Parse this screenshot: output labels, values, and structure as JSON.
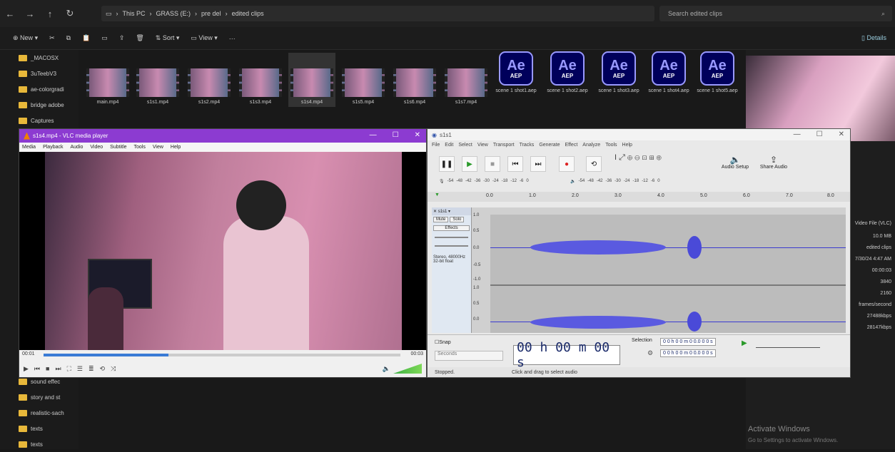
{
  "explorer": {
    "breadcrumbs": [
      "This PC",
      "GRASS (E:)",
      "pre del",
      "edited clips"
    ],
    "search_placeholder": "Search edited clips",
    "toolbar": {
      "new": "New",
      "sort": "Sort",
      "view": "View",
      "more": "···",
      "details": "Details"
    },
    "nav_items": [
      "_MACOSX",
      "3uTeebV3",
      "ae-colorgradi",
      "bridge adobe",
      "Captures",
      "sound effec",
      "story and st",
      "realistic-sach",
      "texts",
      "texts"
    ],
    "files": [
      {
        "name": "main.mp4",
        "kind": "video"
      },
      {
        "name": "s1s1.mp4",
        "kind": "video"
      },
      {
        "name": "s1s2.mp4",
        "kind": "video"
      },
      {
        "name": "s1s3.mp4",
        "kind": "video"
      },
      {
        "name": "s1s4.mp4",
        "kind": "video",
        "selected": true
      },
      {
        "name": "s1s5.mp4",
        "kind": "video"
      },
      {
        "name": "s1s6.mp4",
        "kind": "video"
      },
      {
        "name": "s1s7.mp4",
        "kind": "video"
      },
      {
        "name": "scene 1 shot1.aep",
        "kind": "aep"
      },
      {
        "name": "scene 1 shot2.aep",
        "kind": "aep"
      },
      {
        "name": "scene 1 shot3.aep",
        "kind": "aep"
      },
      {
        "name": "scene 1 shot4.aep",
        "kind": "aep"
      },
      {
        "name": "scene 1 shot5.aep",
        "kind": "aep"
      }
    ],
    "ae_logo": "Ae",
    "aep_badge": "AEP",
    "details_props": [
      "Video File (VLC)",
      "10.0 MB",
      "edited clips",
      "7/30/24 4:47 AM",
      "00:00:03",
      "3840",
      "2160",
      "frames/second",
      "27488kbps",
      "28147kbps"
    ],
    "activate_title": "Activate Windows",
    "activate_sub": "Go to Settings to activate Windows."
  },
  "vlc": {
    "title": "s1s4.mp4 - VLC media player",
    "menu": [
      "Media",
      "Playback",
      "Audio",
      "Video",
      "Subtitle",
      "Tools",
      "View",
      "Help"
    ],
    "time_elapsed": "00:01",
    "time_total": "00:03",
    "progress": 0.35,
    "volume_label": "80%"
  },
  "audacity": {
    "title": "s1s1",
    "menu": [
      "File",
      "Edit",
      "Select",
      "View",
      "Transport",
      "Tracks",
      "Generate",
      "Effect",
      "Analyze",
      "Tools",
      "Help"
    ],
    "audio_setup": "Audio Setup",
    "share_audio": "Share Audio",
    "meter_ticks": [
      "-54",
      "-48",
      "-42",
      "-36",
      "-30",
      "-24",
      "-18",
      "-12",
      "-6",
      "0"
    ],
    "timeline_ticks": [
      "0.0",
      "1.0",
      "2.0",
      "3.0",
      "4.0",
      "5.0",
      "6.0",
      "7.0",
      "8.0"
    ],
    "track_name": "s1s1",
    "mute": "Mute",
    "solo": "Solo",
    "effects": "Effects",
    "track_info": "Stereo, 48000Hz 32-bit float",
    "amp_ticks": [
      "1.0",
      "0.5",
      "0.0",
      "-0.5",
      "-1.0"
    ],
    "snap": "Snap",
    "seconds": "Seconds",
    "time_display": "00 h 00 m 00 s",
    "selection": "Selection",
    "sel_start": "0 0 h 0 0 m 0 0.0 0 0 s",
    "sel_end": "0 0 h 0 0 m 0 0.0 0 0 s",
    "status_left": "Stopped.",
    "status_right": "Click and drag to select audio"
  }
}
